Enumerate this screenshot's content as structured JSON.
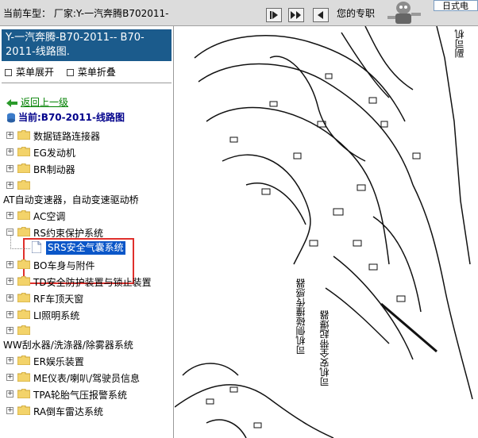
{
  "topbar": {
    "current_model": "当前车型： 厂家:Y-一汽奔腾B702011-",
    "promo": "您的专职",
    "promo2": "日式电",
    "nav_buttons": [
      "play-icon",
      "fast-forward-icon",
      "step-back-icon"
    ]
  },
  "left": {
    "header": "Y-一汽奔腾-B70-2011-- B70-2011-线路图.",
    "expand": "菜单展开",
    "collapse": "菜单折叠",
    "back": "返回上一级",
    "current": "当前:B70-2011-线路图",
    "items": [
      {
        "label": "数据链路连接器",
        "kind": "folder"
      },
      {
        "label": "EG发动机",
        "kind": "folder"
      },
      {
        "label": "BR制动器",
        "kind": "folder"
      },
      {
        "label": "",
        "kind": "folder"
      },
      {
        "label": "AT自动变速器，自动变速驱动桥",
        "kind": "plain"
      },
      {
        "label": "AC空调",
        "kind": "folder"
      },
      {
        "label": "RS约束保护系统",
        "kind": "folder-open"
      },
      {
        "label": "SRS安全气囊系统",
        "kind": "doc"
      },
      {
        "label": "BO车身与附件",
        "kind": "folder"
      },
      {
        "label": "TD安全防护装置与锁止装置",
        "kind": "folder"
      },
      {
        "label": "RF车顶天窗",
        "kind": "folder"
      },
      {
        "label": "LI照明系统",
        "kind": "folder"
      },
      {
        "label": "",
        "kind": "folder"
      },
      {
        "label": "WW刮水器/洗涤器/除雾器系统",
        "kind": "plain"
      },
      {
        "label": "ER娱乐装置",
        "kind": "folder"
      },
      {
        "label": "ME仪表/喇叭/驾驶员信息",
        "kind": "folder"
      },
      {
        "label": "TPA轮胎气压报警系统",
        "kind": "folder"
      },
      {
        "label": "RA倒车雷达系统",
        "kind": "folder"
      }
    ]
  },
  "diagram": {
    "label_top": "副司机",
    "label_sensor": "司机侧碰撞传感器",
    "label_belt": "司机安全带起爆器"
  },
  "colors": {
    "header_bg": "#1b5b8c",
    "selected_bg": "#0a56c8",
    "highlight": "#e0302c",
    "link": "#008000"
  }
}
